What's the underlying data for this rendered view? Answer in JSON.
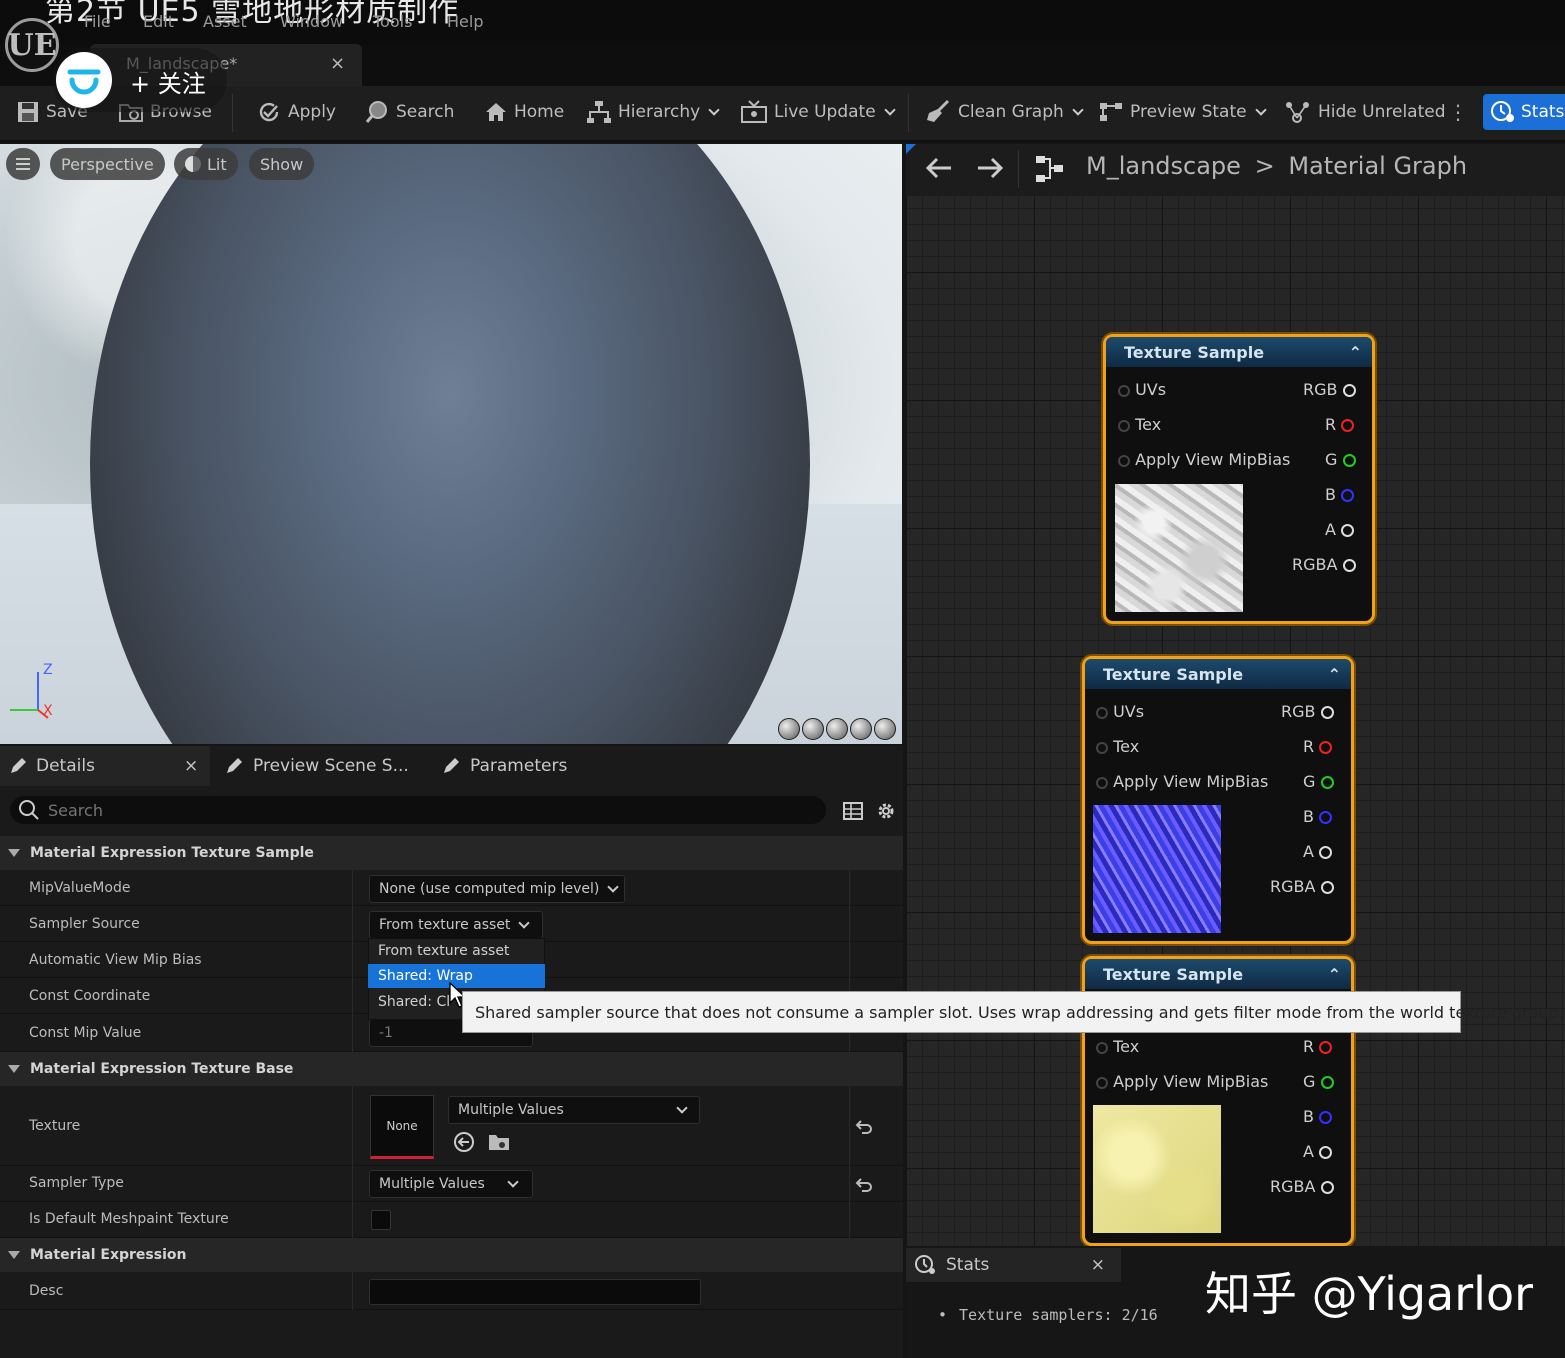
{
  "video_title": "第2节 UE5 雪地地形材质制作",
  "menu": [
    "File",
    "Edit",
    "Asset",
    "Window",
    "Tools",
    "Help"
  ],
  "app_logo": "UE",
  "doc_tab": {
    "title": "M_landscape*",
    "close": "×"
  },
  "follow": {
    "label": "+ 关注"
  },
  "toolbar": {
    "save": "Save",
    "browse": "Browse",
    "apply": "Apply",
    "search": "Search",
    "home": "Home",
    "hierarchy": "Hierarchy",
    "live_update": "Live Update",
    "clean_graph": "Clean Graph",
    "preview_state": "Preview State",
    "hide_unrelated": "Hide Unrelated",
    "stats": "Stats"
  },
  "viewport": {
    "perspective": "Perspective",
    "lit": "Lit",
    "show": "Show",
    "axis_z": "Z",
    "axis_x": "X"
  },
  "details": {
    "tabs": [
      "Details",
      "Preview Scene S...",
      "Parameters"
    ],
    "close": "×",
    "search_placeholder": "Search",
    "sections": [
      "Material Expression Texture Sample",
      "Material Expression Texture Base",
      "Material Expression"
    ],
    "rows": {
      "mip_value_mode": {
        "label": "MipValueMode",
        "value": "None (use computed mip level)"
      },
      "sampler_source": {
        "label": "Sampler Source",
        "value": "From texture asset"
      },
      "auto_mip_bias": {
        "label": "Automatic View Mip Bias"
      },
      "const_coordinate": {
        "label": "Const Coordinate"
      },
      "const_mip_value": {
        "label": "Const Mip Value",
        "value": "-1"
      },
      "texture": {
        "label": "Texture",
        "thumb": "None",
        "value": "Multiple Values"
      },
      "sampler_type": {
        "label": "Sampler Type",
        "value": "Multiple Values"
      },
      "default_meshpaint": {
        "label": "Is Default Meshpaint Texture"
      },
      "desc": {
        "label": "Desc"
      }
    },
    "dropdown": [
      "From texture asset",
      "Shared: Wrap",
      "Shared: Cl"
    ],
    "tooltip": "Shared sampler source that does not consume a sampler slot.  Uses wrap addressing and gets filter mode from the world texture group."
  },
  "graph": {
    "breadcrumb_asset": "M_landscape",
    "breadcrumb_sep": ">",
    "breadcrumb_graph": "Material Graph",
    "node_title": "Texture Sample",
    "inputs": [
      "UVs",
      "Tex",
      "Apply View MipBias"
    ],
    "outputs": [
      "RGB",
      "R",
      "G",
      "B",
      "A",
      "RGBA"
    ],
    "colors": {
      "node_border": "#f0a21a",
      "r": "#e22",
      "g": "#2c2",
      "b": "#33f",
      "header": "#1d4a6c"
    }
  },
  "stats": {
    "tab": "Stats",
    "close": "×",
    "bullet": "•",
    "line": "Texture samplers: 2/16"
  },
  "watermark": "知乎 @Yigarlor",
  "accent": "#1b6fd6"
}
